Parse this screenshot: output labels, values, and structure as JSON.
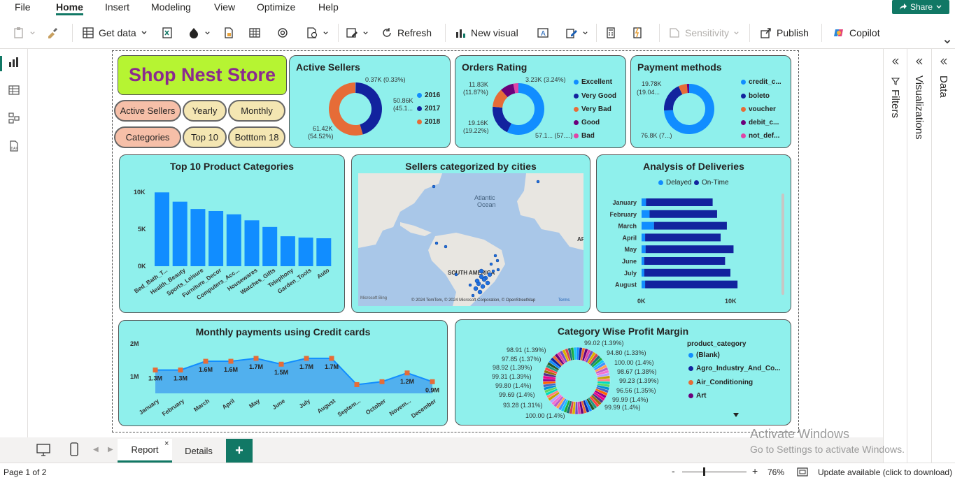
{
  "menu": {
    "file": "File",
    "home": "Home",
    "insert": "Insert",
    "modeling": "Modeling",
    "view": "View",
    "optimize": "Optimize",
    "help": "Help",
    "share": "Share"
  },
  "ribbon": {
    "get_data": "Get data",
    "refresh": "Refresh",
    "new_visual": "New visual",
    "sensitivity": "Sensitivity",
    "publish": "Publish",
    "copilot": "Copilot"
  },
  "report": {
    "logo": "Shop Nest Store",
    "buttons": {
      "active_sellers": "Active Sellers",
      "yearly": "Yearly",
      "monthly": "Monthly",
      "categories": "Categories",
      "top10": "Top 10",
      "bottom18": "Botttom 18"
    },
    "active_sellers": {
      "title": "Active Sellers",
      "legend": [
        "2016",
        "2017",
        "2018"
      ],
      "labels": {
        "a": "0.37K (0.33%)",
        "b1": "50.86K",
        "b2": "(45.1...",
        "c1": "61.42K",
        "c2": "(54.52%)"
      }
    },
    "orders_rating": {
      "title": "Orders Rating",
      "legend": [
        "Excellent",
        "Very Good",
        "Very Bad",
        "Good",
        "Bad"
      ],
      "labels": {
        "a": "3.23K (3.24%)",
        "b1": "11.83K",
        "b2": "(11.87%)",
        "c1": "19.16K",
        "c2": "(19.22%)",
        "d": "57.1... (57....)"
      }
    },
    "payment_methods": {
      "title": "Payment methods",
      "legend": [
        "credit_c...",
        "boleto",
        "voucher",
        "debit_c...",
        "not_def..."
      ],
      "labels": {
        "a1": "19.78K",
        "a2": "(19.04...",
        "b": "76.8K (7...)"
      }
    },
    "top10": {
      "title": "Top 10 Product Categories",
      "yticks": [
        "10K",
        "5K",
        "0K"
      ]
    },
    "cities": {
      "title": "Sellers categorized by cities",
      "ocean": "Atlantic",
      "ocean2": "Ocean",
      "continent": "SOUTH AMERICA",
      "edge": "AF",
      "provider": "Microsoft Bing",
      "copyright": "© 2024 TomTom, © 2024 Microsoft Corporation, © OpenStreetMap",
      "terms": "Terms"
    },
    "deliveries": {
      "title": "Analysis of Deliveries",
      "legend": [
        "Delayed",
        "On-Time"
      ],
      "xticks": [
        "0K",
        "10K"
      ]
    },
    "credit": {
      "title": "Monthly payments using Credit cards",
      "yticks": [
        "2M",
        "1M"
      ]
    },
    "profit": {
      "title": "Category Wise Profit Margin",
      "legend_title": "product_category",
      "legend": [
        "(Blank)",
        "Agro_Industry_And_Co...",
        "Air_Conditioning",
        "Art"
      ],
      "labels_left": [
        "98.91 (1.39%)",
        "97.85 (1.37%)",
        "98.92 (1.39%)",
        "99.31 (1.39%)",
        "99.80 (1.4%)",
        "99.69 (1.4%)",
        "93.28 (1.31%)",
        "100.00 (1.4%)"
      ],
      "labels_right": [
        "99.02 (1.39%)",
        "94.80 (1.33%)",
        "100.00 (1.4%)",
        "98.67 (1.38%)",
        "99.23 (1.39%)",
        "96.56 (1.35%)",
        "99.99 (1.4%)",
        "99.99 (1.4%)"
      ]
    }
  },
  "chart_data": [
    {
      "type": "pie",
      "title": "Active Sellers",
      "categories": [
        "2016",
        "2017",
        "2018"
      ],
      "values": [
        0.37,
        50.86,
        61.42
      ],
      "colors": [
        "#118dff",
        "#12239e",
        "#e66c37"
      ]
    },
    {
      "type": "pie",
      "title": "Orders Rating",
      "categories": [
        "Excellent",
        "Very Good",
        "Very Bad",
        "Good",
        "Bad"
      ],
      "values": [
        57.1,
        19.16,
        11.83,
        8.5,
        3.23
      ],
      "colors": [
        "#118dff",
        "#12239e",
        "#e66c37",
        "#6b007b",
        "#e044a7"
      ]
    },
    {
      "type": "pie",
      "title": "Payment methods",
      "categories": [
        "credit_c...",
        "boleto",
        "voucher",
        "debit_c...",
        "not_def..."
      ],
      "values": [
        76.8,
        19.78,
        5.7,
        1.5,
        0.01
      ],
      "colors": [
        "#118dff",
        "#12239e",
        "#e66c37",
        "#6b007b",
        "#e044a7"
      ]
    },
    {
      "type": "bar",
      "title": "Top 10 Product Categories",
      "categories": [
        "Bed_Bath_T...",
        "Health_Beauty",
        "Sports_Leisure",
        "Furniture_Decor",
        "Computers_Acc...",
        "Housewares",
        "Watches_Gifts",
        "Telephony",
        "Garden_Tools",
        "Auto"
      ],
      "values": [
        11100,
        9700,
        8600,
        8300,
        7800,
        6900,
        5900,
        4500,
        4300,
        4200
      ],
      "ylim": [
        0,
        12500
      ],
      "color": "#118dff"
    },
    {
      "type": "bar",
      "title": "Analysis of Deliveries",
      "orientation": "horizontal",
      "categories": [
        "January",
        "February",
        "March",
        "April",
        "May",
        "June",
        "July",
        "August"
      ],
      "series": [
        {
          "name": "Delayed",
          "values": [
            500,
            900,
            1400,
            400,
            450,
            300,
            300,
            400
          ]
        },
        {
          "name": "On-Time",
          "values": [
            7500,
            7600,
            8200,
            8500,
            9900,
            9100,
            9700,
            10400
          ]
        }
      ],
      "xlim": [
        0,
        11000
      ]
    },
    {
      "type": "area",
      "title": "Monthly payments using Credit cards",
      "categories": [
        "January",
        "February",
        "March",
        "April",
        "May",
        "June",
        "July",
        "August",
        "Septem...",
        "October",
        "Novem...",
        "December"
      ],
      "values": [
        1.3,
        1.3,
        1.6,
        1.6,
        1.7,
        1.5,
        1.7,
        1.7,
        0.8,
        0.9,
        1.2,
        0.9
      ],
      "point_labels": [
        "1.3M",
        "1.3M",
        "1.6M",
        "1.6M",
        "1.7M",
        "1.5M",
        "1.7M",
        "1.7M",
        "",
        "",
        "1.2M",
        "0.9M"
      ],
      "ylim": [
        0.5,
        2.2
      ]
    }
  ],
  "tabs": {
    "report": "Report",
    "details": "Details",
    "add": "+"
  },
  "status": {
    "page": "Page 1 of 2",
    "zoom": "76%",
    "update": "Update available (click to download)"
  },
  "watermark": {
    "line1": "Activate Windows",
    "line2": "Go to Settings to activate Windows."
  },
  "panes": {
    "filters": "Filters",
    "visualizations": "Visualizations",
    "data": "Data"
  }
}
